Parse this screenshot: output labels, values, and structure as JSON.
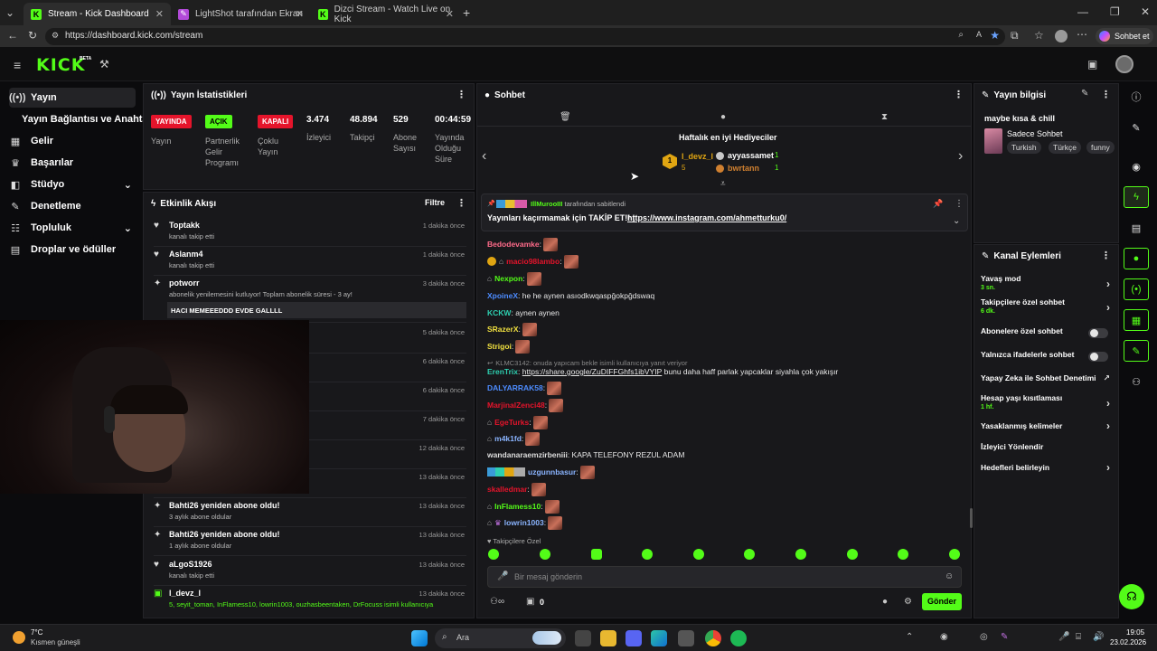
{
  "browser": {
    "tabs": [
      {
        "title": "Stream - Kick Dashboard",
        "active": true
      },
      {
        "title": "LightShot tarafından Ekran Görünt",
        "active": false
      },
      {
        "title": "Dizci Stream - Watch Live on Kick",
        "active": false
      }
    ],
    "url": "https://dashboard.kick.com/stream",
    "profile_label": "Sohbet et"
  },
  "kick": {
    "logo": "KICK",
    "beta": "BETA"
  },
  "nav": {
    "items": [
      {
        "label": "Yayın",
        "icon": "broadcast-icon",
        "active": true
      },
      {
        "label": "Yayın Bağlantısı ve Anahtarı",
        "icon": "",
        "active": false
      },
      {
        "label": "Gelir",
        "icon": "revenue-icon",
        "active": false
      },
      {
        "label": "Başarılar",
        "icon": "trophy-icon",
        "active": false
      },
      {
        "label": "Stüdyo",
        "icon": "studio-icon",
        "active": false
      },
      {
        "label": "Denetleme",
        "icon": "wrench-icon",
        "active": false
      },
      {
        "label": "Topluluk",
        "icon": "community-icon",
        "active": false
      },
      {
        "label": "Droplar ve ödüller",
        "icon": "drops-icon",
        "active": false
      }
    ]
  },
  "stats": {
    "title": "Yayın İstatistikleri",
    "items": [
      {
        "badge": "YAYINDA",
        "badge_color": "#e5142b",
        "label": "Yayın"
      },
      {
        "badge": "AÇIK",
        "badge_color": "#53fc18",
        "label": "Partnerlik Gelir Programı"
      },
      {
        "badge": "KAPALI",
        "badge_color": "#e5142b",
        "label": "Çoklu Yayın"
      },
      {
        "value": "3.474",
        "label": "İzleyici"
      },
      {
        "value": "48.894",
        "label": "Takipçi"
      },
      {
        "value": "529",
        "label": "Abone Sayısı"
      },
      {
        "value": "00:44:59",
        "label": "Yayında Olduğu Süre"
      }
    ]
  },
  "activity": {
    "title": "Etkinlik Akışı",
    "filter": "Filtre",
    "items": [
      {
        "name": "Toptakk",
        "desc": "kanalı takip etti",
        "time": "1 dakika önce",
        "icon": "heart-icon"
      },
      {
        "name": "Aslanm4",
        "desc": "kanalı takip etti",
        "time": "1 dakika önce",
        "icon": "heart-icon"
      },
      {
        "name": "potworr",
        "desc": "abonelik yenilemesini kutluyor! Toplam abonelik süresi - 3 ay!",
        "time": "3 dakika önce",
        "icon": "sparkle-icon",
        "quote": "HACI MEMEEEDDD EVDE GALLLL"
      },
      {
        "time": "5 dakika önce"
      },
      {
        "time": "6 dakika önce"
      },
      {
        "time": "6 dakika önce"
      },
      {
        "time": "7 dakika önce"
      },
      {
        "time": "12 dakika önce"
      },
      {
        "time": "13 dakika önce"
      },
      {
        "name": "Bahti26 yeniden abone oldu!",
        "desc": "3 aylık abone oldular",
        "time": "13 dakika önce",
        "icon": "sparkle-icon"
      },
      {
        "name": "Bahti26 yeniden abone oldu!",
        "desc": "1 aylık abone oldular",
        "time": "13 dakika önce",
        "icon": "sparkle-icon"
      },
      {
        "name": "aLgoS1926",
        "desc": "kanalı takip etti",
        "time": "13 dakika önce",
        "icon": "heart-icon"
      },
      {
        "name": "l_devz_l",
        "desc": "5, seyit_toman, InFlamess10, lowrin1003, ouzhasbeentaken, DrFocuss isimli kullanıcıya",
        "time": "13 dakika önce",
        "icon": "gift-icon"
      }
    ]
  },
  "chat": {
    "title": "Sohbet",
    "top_gifters_title": "Haftalık en iyi Hediyeciler",
    "gifters": [
      {
        "name": "l_devz_l",
        "count": "5"
      },
      {
        "name": "ayyassamet",
        "count": "1"
      },
      {
        "name": "bwrtann",
        "count": "1"
      }
    ],
    "pinned_by": "IllMurooIII tarafından sabitlendi",
    "pinned_text": "Yayınları kaçırmamak için TAKİP ET!! |",
    "pinned_link": "https://www.instagram.com/ahmetturku0/",
    "messages": [
      {
        "user": "Bedodevamke",
        "color": "#ff6b8a",
        "text": "",
        "emote": true
      },
      {
        "user": "macio98lambo",
        "color": "#e5142b",
        "text": "",
        "emote": true
      },
      {
        "user": "Nexpon",
        "color": "#53fc18",
        "text": "",
        "emote": true
      },
      {
        "user": "XpoineX",
        "color": "#4d8cff",
        "text": "he he aynen asıodkwqaspğokpğdswaq"
      },
      {
        "user": "KCKW",
        "color": "#2ecfb0",
        "text": "aynen aynen"
      },
      {
        "user": "SRazerX",
        "color": "#f0e040",
        "text": "",
        "emote": true
      },
      {
        "user": "Strigoi",
        "color": "#f0e040",
        "text": "",
        "emote": true
      },
      {
        "user": "",
        "color": "#888888",
        "text": "KLMC3142: onuda yapıcam bekle isimli kullanıcıya yanıt veriyor",
        "reply": true
      },
      {
        "user": "ErenTrix",
        "color": "#2ecfb0",
        "text": "bunu daha haff parlak yapcaklar siyahla çok yakışır",
        "link": "https://share.google/ZuDIFFGhfs1ibVYIP"
      },
      {
        "user": "DALYARRAK58",
        "color": "#4d8cff",
        "text": "",
        "emote": true
      },
      {
        "user": "MarjinalZenci48",
        "color": "#e5142b",
        "text": "",
        "emote": true
      },
      {
        "user": "EgeTurks",
        "color": "#e5142b",
        "text": "",
        "emote": true
      },
      {
        "user": "m4k1fd",
        "color": "#8ab4ff",
        "text": "",
        "emote": true
      },
      {
        "user": "wandanaraemzirbeniii",
        "color": "#dddddd",
        "text": "KAPA TELEFONY REZUL ADAM"
      },
      {
        "user": "uzgunnbasur",
        "color": "#8ab4ff",
        "text": "",
        "emote": true
      },
      {
        "user": "skalledmar",
        "color": "#e5142b",
        "text": "",
        "emote": true
      },
      {
        "user": "InFlamess10",
        "color": "#53fc18",
        "text": "",
        "emote": true
      },
      {
        "user": "lowrin1003",
        "color": "#8ab4ff",
        "text": "",
        "emote": true
      }
    ],
    "followers_only": "Takipçilere Özel",
    "input_placeholder": "Bir mesaj gönderin",
    "points": "0",
    "send": "Gönder"
  },
  "stream_info": {
    "title": "Yayın bilgisi",
    "stream_title": "maybe kısa & chill",
    "category": "Sadece Sohbet",
    "tags": [
      "Turkish",
      "Türkçe",
      "funny"
    ]
  },
  "channel_actions": {
    "title": "Kanal Eylemleri",
    "items": [
      {
        "label": "Yavaş mod",
        "sub": "3 sn.",
        "kind": "chevron"
      },
      {
        "label": "Takipçilere özel sohbet",
        "sub": "6 dk.",
        "kind": "chevron"
      },
      {
        "label": "Abonelere özel sohbet",
        "sub": "",
        "kind": "toggle"
      },
      {
        "label": "Yalnızca ifadelerle sohbet",
        "sub": "",
        "kind": "toggle"
      },
      {
        "label": "Yapay Zeka ile Sohbet Denetimi",
        "sub": "",
        "kind": "external"
      },
      {
        "label": "Hesap yaşı kısıtlaması",
        "sub": "1 hf.",
        "kind": "chevron"
      },
      {
        "label": "Yasaklanmış kelimeler",
        "sub": "",
        "kind": "chevron"
      },
      {
        "label": "İzleyici Yönlendir",
        "sub": "",
        "kind": "none"
      },
      {
        "label": "Hedefleri belirleyin",
        "sub": "",
        "kind": "chevron"
      }
    ]
  },
  "taskbar": {
    "weather_temp": "7°C",
    "weather_desc": "Kısmen güneşli",
    "search": "Ara",
    "time": "19:05",
    "date": "23.02.2026"
  }
}
